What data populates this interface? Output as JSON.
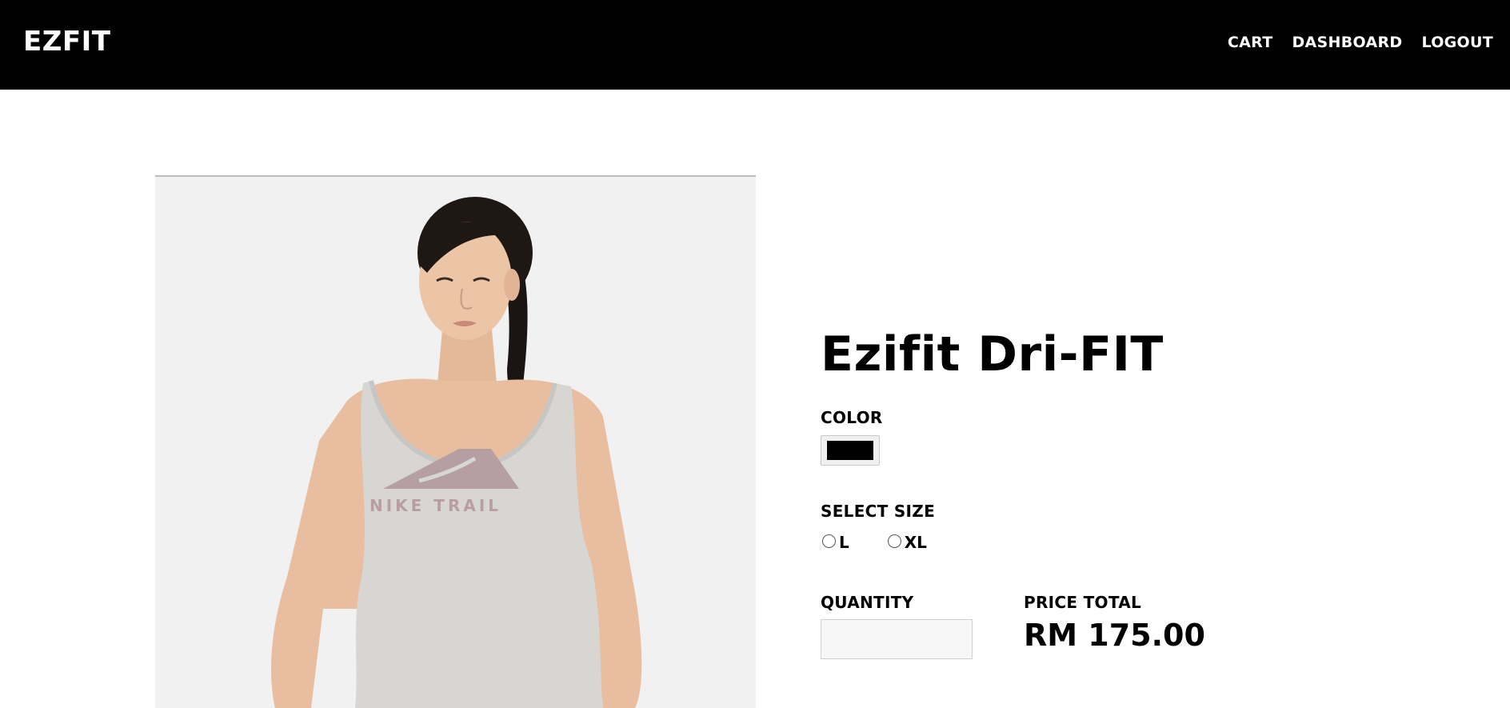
{
  "brand": "EZFIT",
  "nav": {
    "cart": "CART",
    "dashboard": "DASHBOARD",
    "logout": "LOGOUT"
  },
  "product": {
    "title": "Ezifit Dri-FIT",
    "image_text": "NIKE TRAIL",
    "color_label": "COLOR",
    "color": "#000000",
    "size_label": "SELECT SIZE",
    "sizes": [
      {
        "label": "L",
        "selected": false
      },
      {
        "label": "XL",
        "selected": false
      }
    ],
    "quantity_label": "QUANTITY",
    "quantity_value": "",
    "price_label": "PRICE TOTAL",
    "price_total": "RM 175.00"
  }
}
